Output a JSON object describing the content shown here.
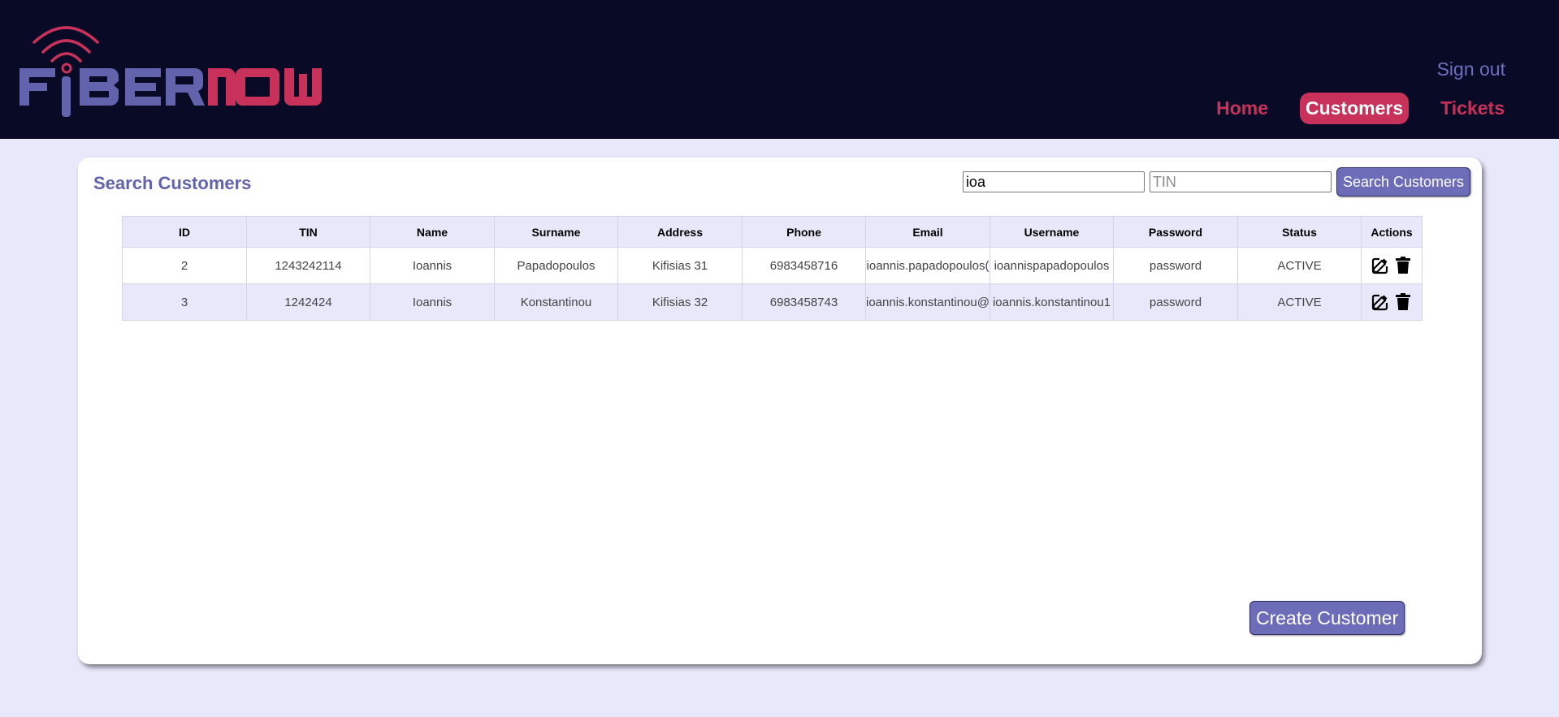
{
  "brand": {
    "logo": "logo-fibernow"
  },
  "header": {
    "signout_label": "Sign out",
    "nav": [
      {
        "label": "Home",
        "active": false
      },
      {
        "label": "Customers",
        "active": true
      },
      {
        "label": "Tickets",
        "active": false
      }
    ]
  },
  "search": {
    "title": "Search Customers",
    "name_value": "ioa",
    "tin_placeholder": "TIN",
    "button_label": "Search Customers"
  },
  "table": {
    "columns": [
      "ID",
      "TIN",
      "Name",
      "Surname",
      "Address",
      "Phone",
      "Email",
      "Username",
      "Password",
      "Status",
      "Actions"
    ],
    "rows": [
      [
        "2",
        "1243242114",
        "Ioannis",
        "Papadopoulos",
        "Kifisias 31",
        "6983458716",
        "ioannis.papadopoulos(",
        "ioannispapadopoulos",
        "password",
        "ACTIVE"
      ],
      [
        "3",
        "1242424",
        "Ioannis",
        "Konstantinou",
        "Kifisias 32",
        "6983458743",
        "ioannis.konstantinou@",
        "ioannis.konstantinou1",
        "password",
        "ACTIVE"
      ]
    ]
  },
  "create_label": "Create Customer",
  "colors": {
    "header_bg": "#090a26",
    "accent_red": "#c8325a",
    "accent_purple": "#6c6cb8",
    "page_bg": "#e8e8fb"
  },
  "icons": {
    "edit": "edit-icon",
    "delete": "trash-icon"
  }
}
